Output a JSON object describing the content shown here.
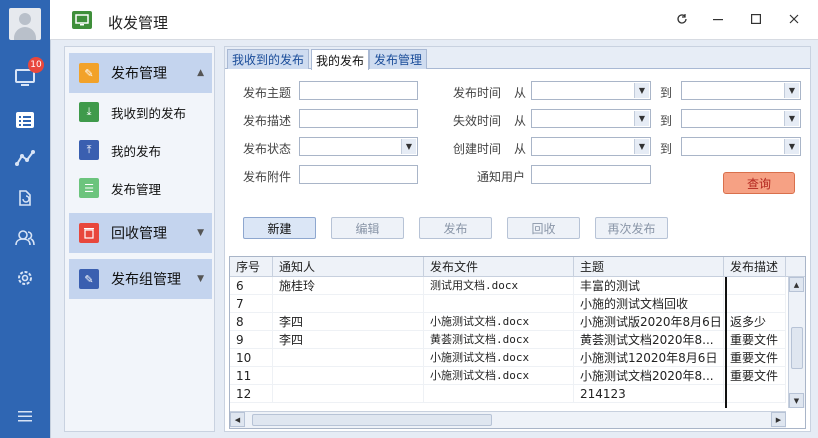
{
  "app": {
    "title": "收发管理"
  },
  "rail": {
    "badge_count": "10",
    "icons": [
      "avatar-icon",
      "monitor-icon",
      "list-icon",
      "chart-line-icon",
      "recycle-icon",
      "users-icon",
      "gear-icon",
      "menu-icon"
    ]
  },
  "nav": {
    "groups": [
      {
        "label": "发布管理",
        "color": "#f2a22a",
        "expanded": true
      },
      {
        "label": "回收管理",
        "color": "#e8473c",
        "expanded": false
      },
      {
        "label": "发布组管理",
        "color": "#3a5fb0",
        "expanded": false
      }
    ],
    "items": [
      {
        "label": "我收到的发布",
        "color": "#3f9a4b"
      },
      {
        "label": "我的发布",
        "color": "#3a5fb0"
      },
      {
        "label": "发布管理",
        "color": "#6cc47d"
      }
    ]
  },
  "tabs": [
    {
      "label": "我收到的发布",
      "active": false
    },
    {
      "label": "我的发布",
      "active": true
    },
    {
      "label": "发布管理",
      "active": false
    }
  ],
  "form": {
    "subject_label": "发布主题",
    "desc_label": "发布描述",
    "status_label": "发布状态",
    "attach_label": "发布附件",
    "pubtime_label": "发布时间",
    "expire_label": "失效时间",
    "create_label": "创建时间",
    "notify_label": "通知用户",
    "from_label": "从",
    "to_label": "到",
    "subject_value": "",
    "desc_value": "",
    "status_value": "",
    "attach_value": "",
    "notify_value": ""
  },
  "buttons": {
    "query": "查询",
    "new": "新建",
    "edit": "编辑",
    "publish": "发布",
    "recall": "回收",
    "republish": "再次发布"
  },
  "table": {
    "headers": [
      "序号",
      "通知人",
      "发布文件",
      "主题",
      "发布描述"
    ],
    "rows": [
      [
        "6",
        "施桂玲",
        "测试用文档.docx",
        "丰富的测试",
        ""
      ],
      [
        "7",
        "",
        "",
        "小施的测试文档回收",
        ""
      ],
      [
        "8",
        "李四",
        "小施测试文档.docx",
        "小施测试版2020年8月6日",
        "返多少"
      ],
      [
        "9",
        "李四",
        "黄荟测试文档.docx",
        "黄荟测试文档2020年8...",
        "重要文件"
      ],
      [
        "10",
        "",
        "小施测试文档.docx",
        "小施测试12020年8月6日",
        "重要文件"
      ],
      [
        "11",
        "",
        "小施测试文档.docx",
        "小施测试文档2020年8...",
        "重要文件"
      ],
      [
        "12",
        "",
        "",
        "214123",
        ""
      ]
    ]
  }
}
